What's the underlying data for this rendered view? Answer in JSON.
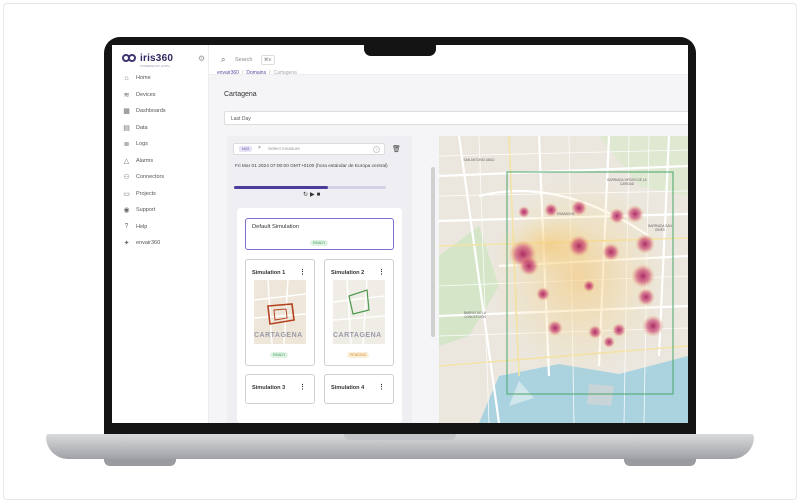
{
  "app": {
    "logo_text": "iris360",
    "logo_sub": "POWERED BY HOPU"
  },
  "sidebar": {
    "items": [
      {
        "label": "Home",
        "icon": "home-icon",
        "glyph": "⌂"
      },
      {
        "label": "Devices",
        "icon": "wifi-icon",
        "glyph": "≋"
      },
      {
        "label": "Dashboards",
        "icon": "dashboard-icon",
        "glyph": "▦"
      },
      {
        "label": "Data",
        "icon": "database-icon",
        "glyph": "▤"
      },
      {
        "label": "Logs",
        "icon": "logs-icon",
        "glyph": "≣"
      },
      {
        "label": "Alarms",
        "icon": "bell-icon",
        "glyph": "△"
      },
      {
        "label": "Connectors",
        "icon": "connector-icon",
        "glyph": "⚇"
      },
      {
        "label": "Projects",
        "icon": "folder-icon",
        "glyph": "▭"
      },
      {
        "label": "Support",
        "icon": "support-icon",
        "glyph": "◉"
      },
      {
        "label": "Help",
        "icon": "help-icon",
        "glyph": "?"
      },
      {
        "label": "envair360",
        "icon": "envair-icon",
        "glyph": "✦"
      }
    ]
  },
  "topbar": {
    "search_label": "Search",
    "search_shortcut": "⌘K"
  },
  "breadcrumb": {
    "items": [
      "envair360",
      "Domains",
      "Cartagena"
    ]
  },
  "page": {
    "title": "Cartagena",
    "period": "Last Day"
  },
  "panel": {
    "measure_chip": "NO2",
    "measure_placeholder": "Select measure",
    "datetime": "Fri Mar 01 2024 07:00:00 GMT+0100 (hora estándar de Europa central)",
    "progress": 0.62
  },
  "simulations": {
    "default": {
      "title": "Default Simulation",
      "status": "READY"
    },
    "cards": [
      {
        "title": "Simulation 1",
        "status": "READY",
        "thumb_label": "CARTAGENA"
      },
      {
        "title": "Simulation 2",
        "status": "PENDING",
        "thumb_label": "CARTAGENA"
      },
      {
        "title": "Simulation 3"
      },
      {
        "title": "Simulation 4"
      }
    ]
  },
  "map": {
    "labels": [
      "SAN ANTONIO ABAD",
      "BARRIADA VIRGEN DE LA CARIDAD",
      "ENSANCHE",
      "BARRIADA SAN GINÉS",
      "BARRIO DE LA CONCEPCIÓN"
    ]
  },
  "colors": {
    "accent": "#4b3d9c",
    "heat": "#b8326a",
    "ready": "#3d9b5d",
    "pending": "#d48d32"
  }
}
